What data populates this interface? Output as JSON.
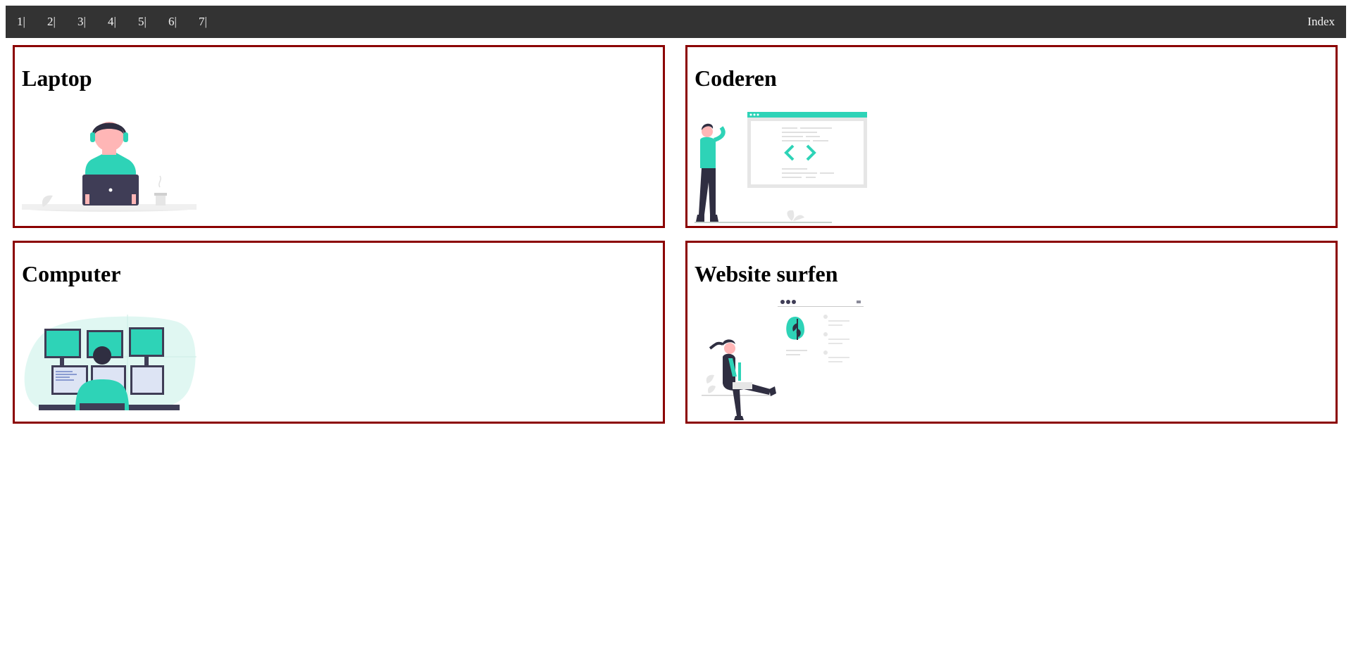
{
  "nav": {
    "links": [
      "1|",
      "2|",
      "3|",
      "4|",
      "5|",
      "6|",
      "7|"
    ],
    "index_label": "Index"
  },
  "cards": [
    {
      "title": "Laptop",
      "illustration": "person-with-laptop-illustration"
    },
    {
      "title": "Coderen",
      "illustration": "coding-woman-illustration"
    },
    {
      "title": "Computer",
      "illustration": "person-at-monitors-illustration"
    },
    {
      "title": "Website surfen",
      "illustration": "woman-browsing-website-illustration"
    }
  ],
  "colors": {
    "nav_bg": "#333333",
    "nav_text": "#f2f2f2",
    "card_border": "#8b0000",
    "accent": "#2ed3b7",
    "dark": "#2f2e41",
    "skin": "#ffb6b6"
  }
}
